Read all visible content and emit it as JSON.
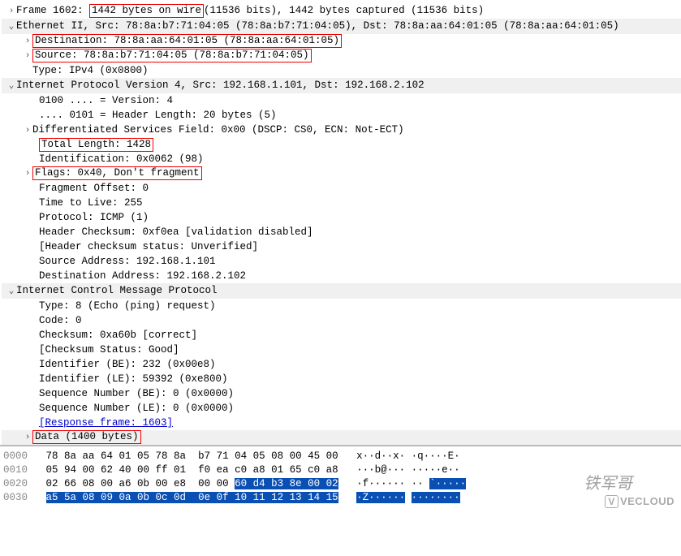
{
  "tree": {
    "frame": {
      "pre": "Frame 1602: ",
      "hl": "1442 bytes on wire ",
      "post": "(11536 bits), 1442 bytes captured (11536 bits)"
    },
    "eth": {
      "header": "Ethernet II, Src: 78:8a:b7:71:04:05 (78:8a:b7:71:04:05), Dst: 78:8a:aa:64:01:05 (78:8a:aa:64:01:05)",
      "dst": "Destination: 78:8a:aa:64:01:05 (78:8a:aa:64:01:05)",
      "src": "Source: 78:8a:b7:71:04:05 (78:8a:b7:71:04:05)",
      "type": "Type: IPv4 (0x0800)"
    },
    "ip": {
      "header": "Internet Protocol Version 4, Src: 192.168.1.101, Dst: 192.168.2.102",
      "version": "0100 .... = Version: 4",
      "hlen": ".... 0101 = Header Length: 20 bytes (5)",
      "dsf": "Differentiated Services Field: 0x00 (DSCP: CS0, ECN: Not-ECT)",
      "totlen": "Total Length: 1428",
      "id": "Identification: 0x0062 (98)",
      "flags": "Flags: 0x40, Don't fragment",
      "foff": "Fragment Offset: 0",
      "ttl": "Time to Live: 255",
      "proto": "Protocol: ICMP (1)",
      "hchk": "Header Checksum: 0xf0ea [validation disabled]",
      "hchkst": "[Header checksum status: Unverified]",
      "saddr": "Source Address: 192.168.1.101",
      "daddr": "Destination Address: 192.168.2.102"
    },
    "icmp": {
      "header": "Internet Control Message Protocol",
      "type": "Type: 8 (Echo (ping) request)",
      "code": "Code: 0",
      "chk": "Checksum: 0xa60b [correct]",
      "chkst": "[Checksum Status: Good]",
      "idbe": "Identifier (BE): 232 (0x00e8)",
      "idle": "Identifier (LE): 59392 (0xe800)",
      "seqbe": "Sequence Number (BE): 0 (0x0000)",
      "seqle": "Sequence Number (LE): 0 (0x0000)",
      "resp": "[Response frame: 1603]",
      "data": "Data (1400 bytes)"
    }
  },
  "hex": {
    "rows": [
      {
        "off": "0000",
        "b1": "78 8a aa 64 01 05 78 8a ",
        "b2": " b7 71 04 05 08 00 45 00",
        "a": "   x··d··x· ·q····E·"
      },
      {
        "off": "0010",
        "b1": "05 94 00 62 40 00 ff 01 ",
        "b2": " f0 ea c0 a8 01 65 c0 a8",
        "a": "   ···b@··· ·····e··"
      },
      {
        "off": "0020",
        "b1": "02 66 08 00 a6 0b 00 e8 ",
        "b2p": " 00 00 ",
        "b2s": "60 d4 b3 8e 00 02",
        "a": "   ·f······ ·· ",
        "as": "`·····"
      },
      {
        "off": "0030",
        "b1s": "a5 5a 08 09 0a 0b 0c 0d ",
        "b2s": " 0e 0f 10 11 12 13 14 15",
        "a": "   ",
        "as1": "·Z······",
        "am": " ",
        "as2": "········"
      }
    ]
  },
  "wm1": "铁军哥",
  "wm2": "VECLOUD"
}
